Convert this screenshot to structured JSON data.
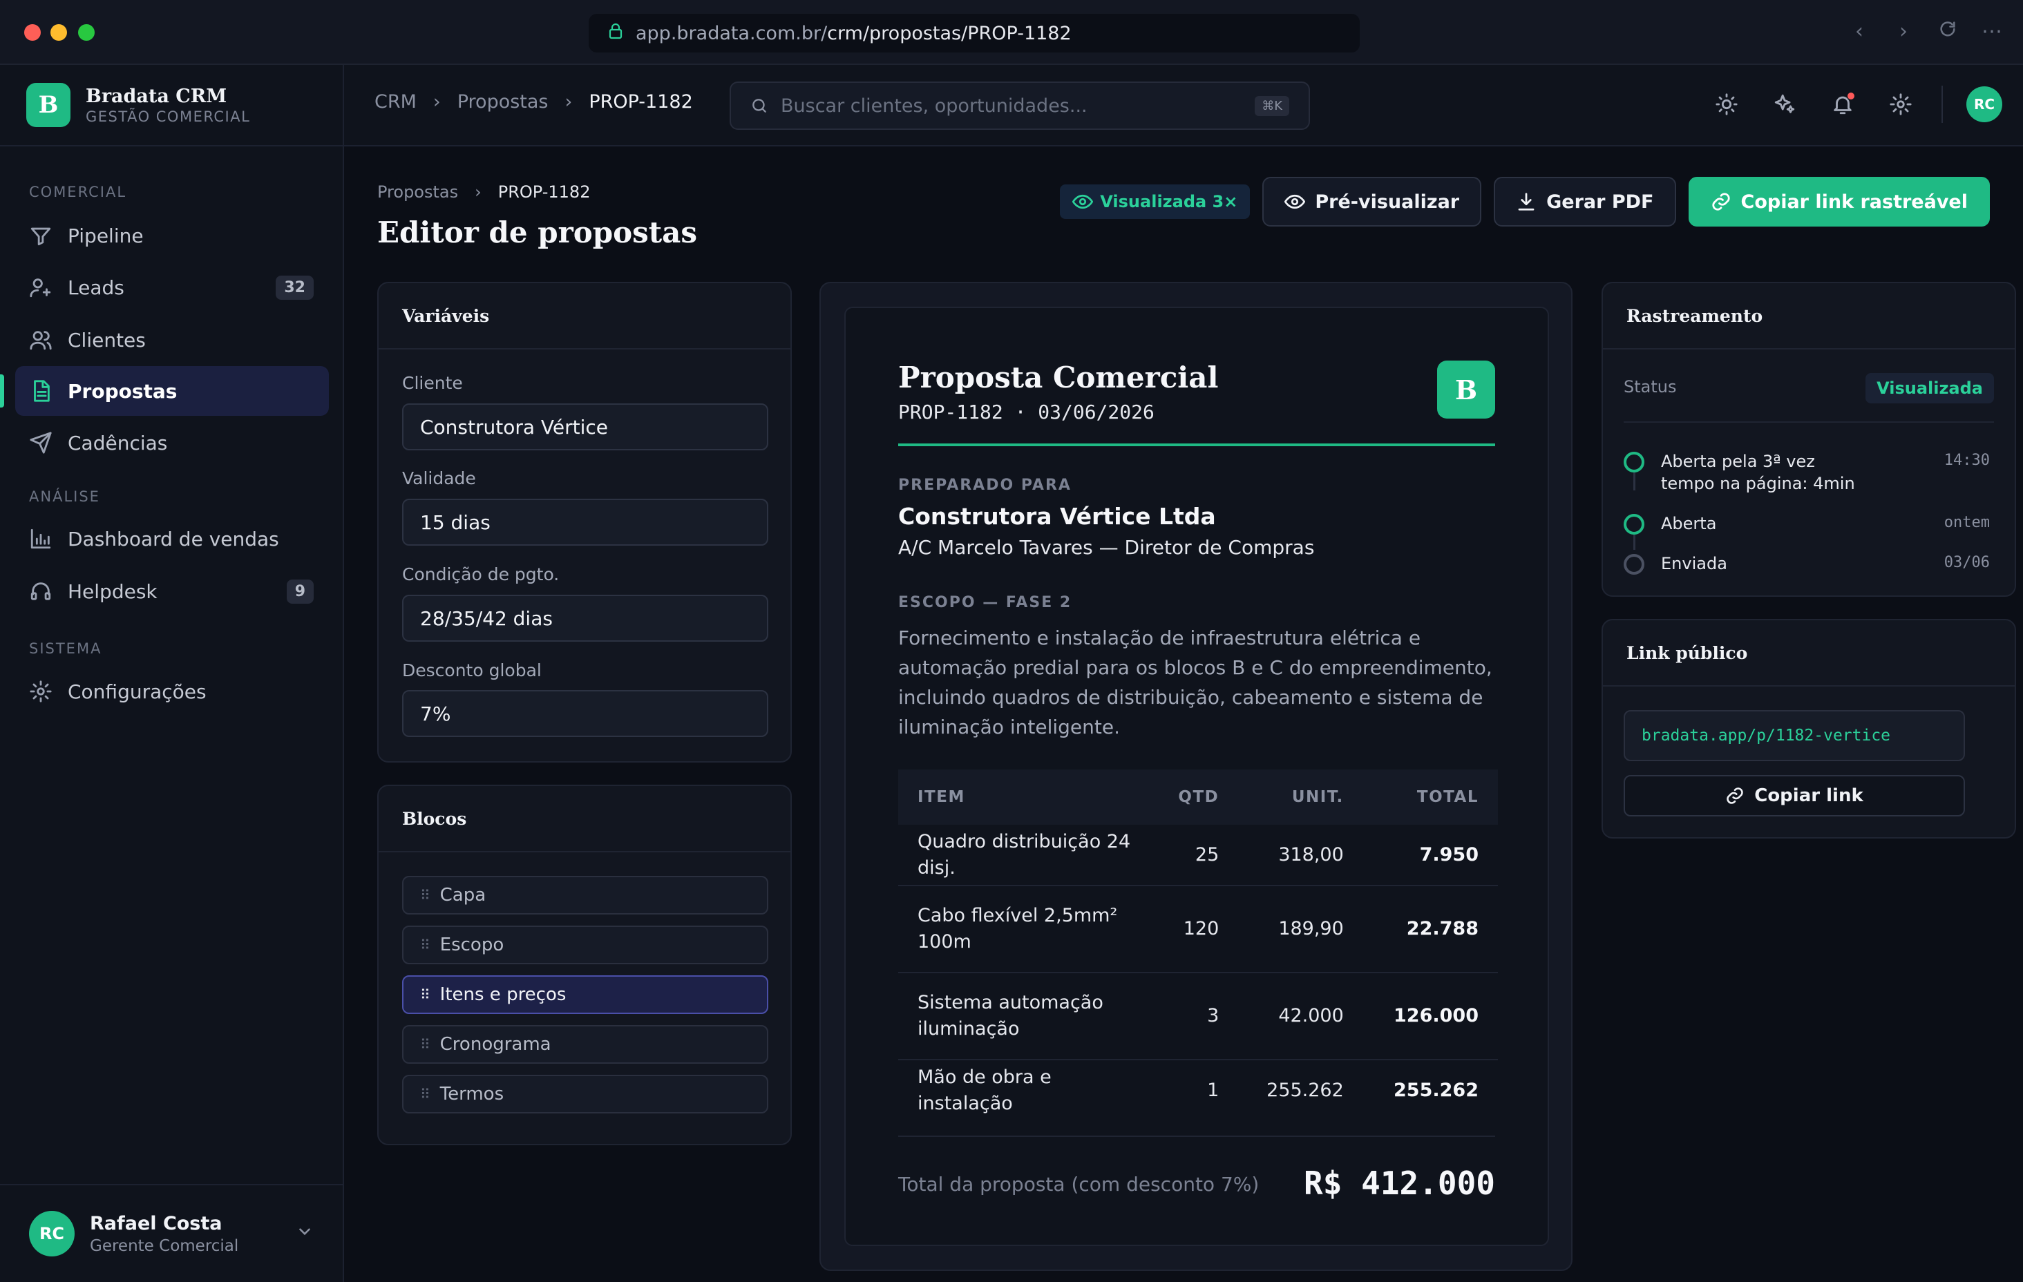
{
  "browser": {
    "url_host": "app.bradata.com.br/",
    "url_path": "crm/propostas/PROP-1182"
  },
  "brand": {
    "logo_letter": "B",
    "name": "Bradata CRM",
    "subtitle": "GESTÃO COMERCIAL"
  },
  "sidebar": {
    "sections": [
      {
        "title": "COMERCIAL"
      },
      {
        "title": "ANÁLISE"
      },
      {
        "title": "SISTEMA"
      }
    ],
    "items": [
      {
        "label": "Pipeline",
        "icon": "filter-icon"
      },
      {
        "label": "Leads",
        "icon": "user-plus-icon",
        "badge": "32"
      },
      {
        "label": "Clientes",
        "icon": "users-icon"
      },
      {
        "label": "Propostas",
        "icon": "document-icon",
        "active": true
      },
      {
        "label": "Cadências",
        "icon": "send-icon"
      },
      {
        "label": "Dashboard de vendas",
        "icon": "bar-chart-icon"
      },
      {
        "label": "Helpdesk",
        "icon": "headset-icon",
        "badge": "9"
      },
      {
        "label": "Configurações",
        "icon": "gear-icon"
      }
    ],
    "user": {
      "initials": "RC",
      "name": "Rafael Costa",
      "role": "Gerente Comercial"
    }
  },
  "topbar": {
    "breadcrumb": [
      "CRM",
      "Propostas",
      "PROP-1182"
    ],
    "search_placeholder": "Buscar clientes, oportunidades...",
    "search_shortcut": "⌘K",
    "avatar_initials": "RC"
  },
  "page": {
    "breadcrumb": [
      "Propostas",
      "PROP-1182"
    ],
    "title": "Editor de propostas",
    "views_label": "Visualizada 3×",
    "preview_button": "Pré-visualizar",
    "pdf_button": "Gerar PDF",
    "copy_tracked_button": "Copiar link rastreável"
  },
  "variables": {
    "title": "Variáveis",
    "fields": [
      {
        "label": "Cliente",
        "value": "Construtora Vértice"
      },
      {
        "label": "Validade",
        "value": "15 dias"
      },
      {
        "label": "Condição de pgto.",
        "value": "28/35/42 dias"
      },
      {
        "label": "Desconto global",
        "value": "7%"
      }
    ]
  },
  "blocks": {
    "title": "Blocos",
    "items": [
      {
        "label": "Capa"
      },
      {
        "label": "Escopo"
      },
      {
        "label": "Itens e preços",
        "selected": true
      },
      {
        "label": "Cronograma"
      },
      {
        "label": "Termos"
      }
    ]
  },
  "document": {
    "title": "Proposta Comercial",
    "subtitle": "PROP-1182 · 03/06/2026",
    "logo_letter": "B",
    "prepared_for_label": "PREPARADO PARA",
    "client": "Construtora Vértice Ltda",
    "attention": "A/C Marcelo Tavares — Diretor de Compras",
    "scope_label": "ESCOPO — FASE 2",
    "scope_text": "Fornecimento e instalação de infraestrutura elétrica e automação predial para os blocos B e C do empreendimento, incluindo quadros de distribuição, cabeamento e sistema de iluminação inteligente.",
    "table_headers": [
      "ITEM",
      "QTD",
      "UNIT.",
      "TOTAL"
    ],
    "items": [
      {
        "item": "Quadro distribuição 24 disj.",
        "qtd": "25",
        "unit": "318,00",
        "total": "7.950"
      },
      {
        "item": "Cabo flexível 2,5mm² 100m",
        "qtd": "120",
        "unit": "189,90",
        "total": "22.788"
      },
      {
        "item": "Sistema automação iluminação",
        "qtd": "3",
        "unit": "42.000",
        "total": "126.000"
      },
      {
        "item": "Mão de obra e instalação",
        "qtd": "1",
        "unit": "255.262",
        "total": "255.262"
      }
    ],
    "total_label": "Total da proposta (com desconto 7%)",
    "total_value": "R$ 412.000"
  },
  "tracking": {
    "title": "Rastreamento",
    "status_label": "Status",
    "status_value": "Visualizada",
    "events": [
      {
        "text": "Aberta pela 3ª vez",
        "detail": "tempo na página: 4min",
        "time": "14:30",
        "state": "done"
      },
      {
        "text": "Aberta",
        "time": "ontem",
        "state": "done"
      },
      {
        "text": "Enviada",
        "time": "03/06",
        "state": "pending"
      }
    ]
  },
  "public_link": {
    "title": "Link público",
    "url": "bradata.app/p/1182-vertice",
    "copy_button": "Copiar link"
  },
  "colors": {
    "accent": "#1fba84",
    "background": "#0b0e16",
    "surface": "#121620"
  }
}
